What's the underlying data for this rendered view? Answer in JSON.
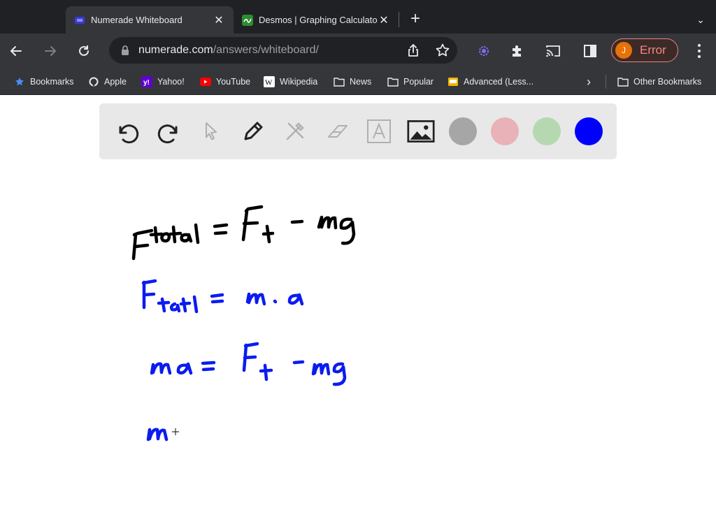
{
  "browser": {
    "tabs": [
      {
        "title": "Numerade Whiteboard",
        "favicon": "numerade-icon",
        "active": true
      },
      {
        "title": "Desmos | Graphing Calculator",
        "favicon": "desmos-icon",
        "active": false
      }
    ],
    "url_host": "numerade.com",
    "url_path": "/answers/whiteboard/",
    "profile": {
      "initial": "J",
      "status": "Error"
    },
    "bookmarks": [
      {
        "label": "Bookmarks",
        "icon": "star-icon"
      },
      {
        "label": "Apple",
        "icon": "apple-icon"
      },
      {
        "label": "Yahoo!",
        "icon": "yahoo-icon"
      },
      {
        "label": "YouTube",
        "icon": "youtube-icon"
      },
      {
        "label": "Wikipedia",
        "icon": "wikipedia-icon"
      },
      {
        "label": "News",
        "icon": "folder-icon"
      },
      {
        "label": "Popular",
        "icon": "folder-icon"
      },
      {
        "label": "Advanced (Less...",
        "icon": "advanced-icon"
      }
    ],
    "other_bookmarks": "Other Bookmarks"
  },
  "whiteboard": {
    "tools": [
      "undo",
      "redo",
      "select",
      "pen",
      "tools",
      "eraser",
      "text",
      "image"
    ],
    "colors": [
      {
        "name": "gray",
        "hex": "#a6a6a6"
      },
      {
        "name": "pink",
        "hex": "#e8b2b8"
      },
      {
        "name": "green",
        "hex": "#b5d8b0"
      },
      {
        "name": "blue",
        "hex": "#0000ff",
        "selected": true
      }
    ],
    "ink_colors": {
      "black": "#000000",
      "blue": "#0b1cf0"
    }
  }
}
